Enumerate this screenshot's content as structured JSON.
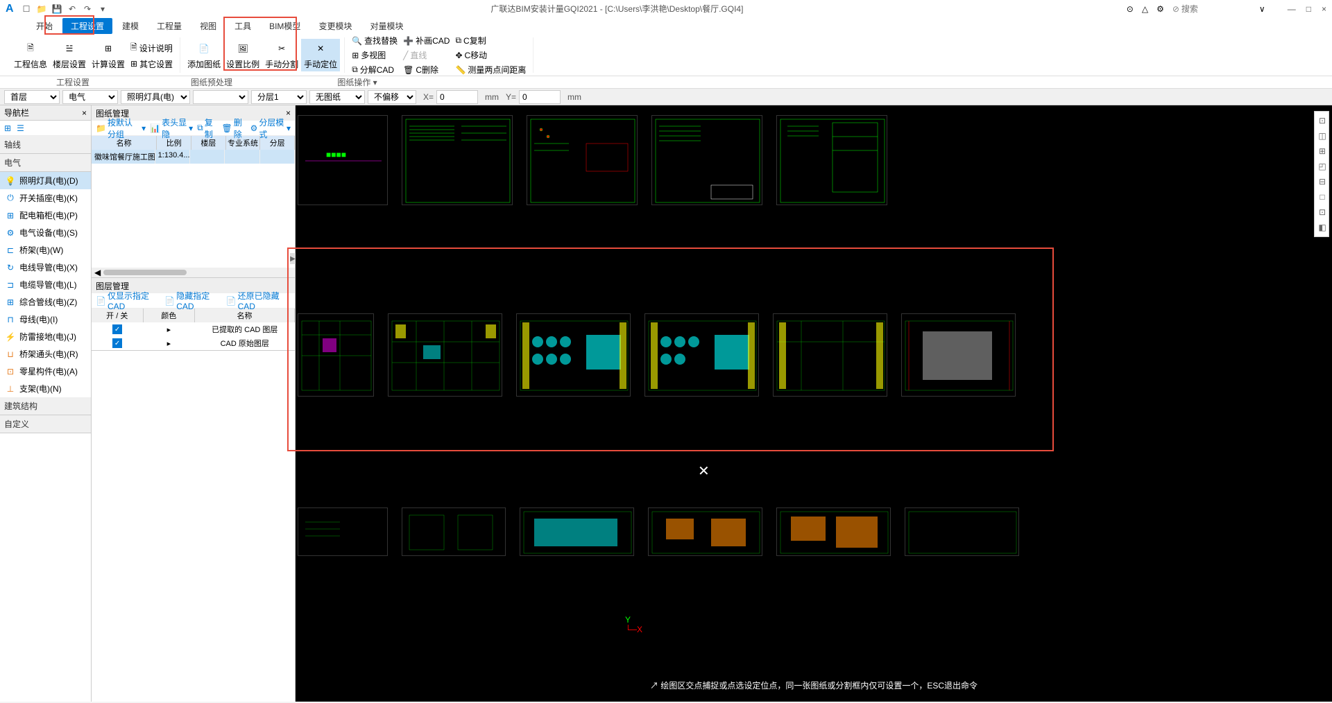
{
  "title": "广联达BIM安装计量GQI2021 - [C:\\Users\\李洪艳\\Desktop\\餐厅.GQI4]",
  "qat": [
    "new",
    "open",
    "save",
    "undo",
    "redo",
    "more"
  ],
  "search_placeholder": "搜索",
  "win": {
    "min": "—",
    "max": "□",
    "close": "×"
  },
  "tabs": [
    "开始",
    "工程设置",
    "建模",
    "工程量",
    "视图",
    "工具",
    "BIM模型",
    "变更模块",
    "对量模块"
  ],
  "ribbon": {
    "g1": {
      "items": [
        "工程信息",
        "楼层设置",
        "计算设置"
      ],
      "extras": [
        "设计说明",
        "其它设置"
      ],
      "label": "工程设置"
    },
    "g2": {
      "items": [
        "添加图纸",
        "设置比例",
        "手动分割",
        "手动定位"
      ],
      "label": "图纸预处理"
    },
    "g3": {
      "col1": [
        "查找替换",
        "多视图",
        "分解CAD"
      ],
      "col2": [
        "补画CAD",
        "直线",
        "C删除"
      ],
      "col3": [
        "C复制",
        "C移动",
        "测量两点间距离"
      ],
      "label": "图纸操作"
    }
  },
  "optionbar": {
    "floor": "首层",
    "major": "电气",
    "comp": "照明灯具(电)",
    "sub": "",
    "layer": "分层1",
    "paper": "无图纸",
    "offset": "不偏移",
    "x_label": "X=",
    "x_val": "0",
    "xu": "mm",
    "y_label": "Y=",
    "y_val": "0",
    "yu": "mm"
  },
  "nav": {
    "title": "导航栏",
    "sections": {
      "axis": "轴线",
      "elec": "电气",
      "struct": "建筑结构",
      "custom": "自定义"
    },
    "items": [
      {
        "label": "照明灯具(电)(D)",
        "active": true
      },
      {
        "label": "开关插座(电)(K)"
      },
      {
        "label": "配电箱柜(电)(P)"
      },
      {
        "label": "电气设备(电)(S)"
      },
      {
        "label": "桥架(电)(W)"
      },
      {
        "label": "电线导管(电)(X)"
      },
      {
        "label": "电缆导管(电)(L)"
      },
      {
        "label": "综合管线(电)(Z)"
      },
      {
        "label": "母线(电)(I)"
      },
      {
        "label": "防雷接地(电)(J)"
      },
      {
        "label": "桥架通头(电)(R)"
      },
      {
        "label": "零星构件(电)(A)"
      },
      {
        "label": "支架(电)(N)"
      }
    ]
  },
  "drawing_mgmt": {
    "title": "图纸管理",
    "toolbar": [
      "按默认分组",
      "表头显隐",
      "复制",
      "删除",
      "分层模式"
    ],
    "headers": [
      "名称",
      "比例",
      "楼层",
      "专业系统",
      "分层"
    ],
    "rows": [
      {
        "name": "徽味馆餐厅施工图  (...",
        "scale": "1:130.4..."
      }
    ]
  },
  "layer_mgmt": {
    "title": "图层管理",
    "toolbar": [
      "仅显示指定CAD",
      "隐藏指定CAD",
      "还原已隐藏CAD"
    ],
    "headers": [
      "开 / 关",
      "颜色",
      "名称"
    ],
    "rows": [
      {
        "on": true,
        "color": "▸",
        "name": "已提取的 CAD 图层"
      },
      {
        "on": true,
        "color": "▸",
        "name": "CAD 原始图层"
      }
    ]
  },
  "status_tip": "绘图区交点捕捉或点选设定位点，同一张图纸或分割框内仅可设置一个，ESC退出命令",
  "axis": {
    "y": "Y",
    "x": "X"
  }
}
